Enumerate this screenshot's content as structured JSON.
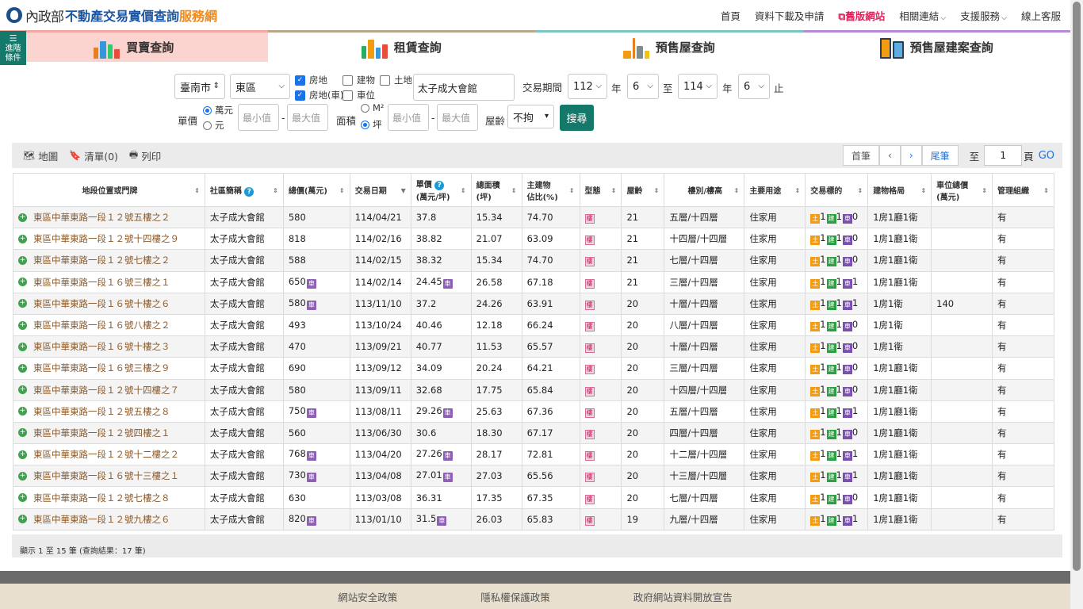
{
  "header": {
    "ministry": "內政部",
    "site_main": "不動產交易實價查詢",
    "site_sub": "服務網",
    "nav": [
      "首頁",
      "資料下載及申請",
      "舊版網站",
      "相關連結",
      "支援服務",
      "線上客服"
    ]
  },
  "advanced": {
    "line1": "進階",
    "line2": "條件"
  },
  "tabs": [
    "買賣查詢",
    "租賃查詢",
    "預售屋查詢",
    "預售屋建案查詢"
  ],
  "filters": {
    "city": "臺南市",
    "district": "東區",
    "types": [
      {
        "label": "房地",
        "checked": true
      },
      {
        "label": "建物",
        "checked": false
      },
      {
        "label": "土地",
        "checked": false
      },
      {
        "label": "房地(車)",
        "checked": true
      },
      {
        "label": "車位",
        "checked": false
      }
    ],
    "keyword": "太子成大會館",
    "period_label": "交易期間",
    "from_year": "112",
    "from_month": "6",
    "to_label": "至",
    "to_year": "114",
    "to_month": "6",
    "year_unit": "年",
    "end_label": "止",
    "unit_price_label": "單價",
    "price_unit_wan": "萬元",
    "price_unit_yuan": "元",
    "min_placeholder": "最小值",
    "max_placeholder": "最大值",
    "area_label": "面積",
    "area_unit_m2": "M²",
    "area_unit_ping": "坪",
    "age_label": "屋齡",
    "age_value": "不拘",
    "search_button": "搜尋"
  },
  "toolbar": {
    "map": "地圖",
    "list": "清單(0)",
    "print": "列印",
    "first": "首筆",
    "last": "尾筆",
    "to_label": "至",
    "page": "1",
    "page_unit": "頁",
    "go": "GO"
  },
  "table": {
    "headers": [
      "地段位置或門牌",
      "社區簡稱",
      "總價(萬元)",
      "交易日期",
      "單價",
      "(萬元/坪)",
      "總面積",
      "(坪)",
      "主建物",
      "佔比(%)",
      "型態",
      "屋齡",
      "樓別/樓高",
      "主要用途",
      "交易標的",
      "建物格局",
      "車位總價",
      "(萬元)",
      "管理組織"
    ],
    "rows": [
      {
        "addr": "東區中華東路一段１２號五樓之２",
        "comm": "太子成大會館",
        "total": "580",
        "tp": false,
        "date": "114/04/21",
        "unit": "37.8",
        "up": false,
        "area": "15.34",
        "ratio": "74.70",
        "age": "21",
        "floor": "五層/十四層",
        "use": "住家用",
        "l": "1",
        "h": "1",
        "c": "0",
        "layout": "1房1廳1衛",
        "park": "",
        "mgmt": "有"
      },
      {
        "addr": "東區中華東路一段１２號十四樓之９",
        "comm": "太子成大會館",
        "total": "818",
        "tp": false,
        "date": "114/02/16",
        "unit": "38.82",
        "up": false,
        "area": "21.07",
        "ratio": "63.09",
        "age": "21",
        "floor": "十四層/十四層",
        "use": "住家用",
        "l": "1",
        "h": "1",
        "c": "0",
        "layout": "1房1廳1衛",
        "park": "",
        "mgmt": "有"
      },
      {
        "addr": "東區中華東路一段１２號七樓之２",
        "comm": "太子成大會館",
        "total": "588",
        "tp": false,
        "date": "114/02/15",
        "unit": "38.32",
        "up": false,
        "area": "15.34",
        "ratio": "74.70",
        "age": "21",
        "floor": "七層/十四層",
        "use": "住家用",
        "l": "1",
        "h": "1",
        "c": "0",
        "layout": "1房1廳1衛",
        "park": "",
        "mgmt": "有"
      },
      {
        "addr": "東區中華東路一段１６號三樓之１",
        "comm": "太子成大會館",
        "total": "650",
        "tp": true,
        "date": "114/02/14",
        "unit": "24.45",
        "up": true,
        "area": "26.58",
        "ratio": "67.18",
        "age": "21",
        "floor": "三層/十四層",
        "use": "住家用",
        "l": "1",
        "h": "1",
        "c": "1",
        "layout": "1房1廳1衛",
        "park": "",
        "mgmt": "有"
      },
      {
        "addr": "東區中華東路一段１６號十樓之６",
        "comm": "太子成大會館",
        "total": "580",
        "tp": true,
        "date": "113/11/10",
        "unit": "37.2",
        "up": false,
        "area": "24.26",
        "ratio": "63.91",
        "age": "20",
        "floor": "十層/十四層",
        "use": "住家用",
        "l": "1",
        "h": "1",
        "c": "1",
        "layout": "1房1衛",
        "park": "140",
        "mgmt": "有"
      },
      {
        "addr": "東區中華東路一段１６號八樓之２",
        "comm": "太子成大會館",
        "total": "493",
        "tp": false,
        "date": "113/10/24",
        "unit": "40.46",
        "up": false,
        "area": "12.18",
        "ratio": "66.24",
        "age": "20",
        "floor": "八層/十四層",
        "use": "住家用",
        "l": "1",
        "h": "1",
        "c": "0",
        "layout": "1房1衛",
        "park": "",
        "mgmt": "有"
      },
      {
        "addr": "東區中華東路一段１６號十樓之３",
        "comm": "太子成大會館",
        "total": "470",
        "tp": false,
        "date": "113/09/21",
        "unit": "40.77",
        "up": false,
        "area": "11.53",
        "ratio": "65.57",
        "age": "20",
        "floor": "十層/十四層",
        "use": "住家用",
        "l": "1",
        "h": "1",
        "c": "0",
        "layout": "1房1衛",
        "park": "",
        "mgmt": "有"
      },
      {
        "addr": "東區中華東路一段１６號三樓之９",
        "comm": "太子成大會館",
        "total": "690",
        "tp": false,
        "date": "113/09/12",
        "unit": "34.09",
        "up": false,
        "area": "20.24",
        "ratio": "64.21",
        "age": "20",
        "floor": "三層/十四層",
        "use": "住家用",
        "l": "1",
        "h": "1",
        "c": "0",
        "layout": "1房1廳1衛",
        "park": "",
        "mgmt": "有"
      },
      {
        "addr": "東區中華東路一段１２號十四樓之７",
        "comm": "太子成大會館",
        "total": "580",
        "tp": false,
        "date": "113/09/11",
        "unit": "32.68",
        "up": false,
        "area": "17.75",
        "ratio": "65.84",
        "age": "20",
        "floor": "十四層/十四層",
        "use": "住家用",
        "l": "1",
        "h": "1",
        "c": "0",
        "layout": "1房1廳1衛",
        "park": "",
        "mgmt": "有"
      },
      {
        "addr": "東區中華東路一段１２號五樓之８",
        "comm": "太子成大會館",
        "total": "750",
        "tp": true,
        "date": "113/08/11",
        "unit": "29.26",
        "up": true,
        "area": "25.63",
        "ratio": "67.36",
        "age": "20",
        "floor": "五層/十四層",
        "use": "住家用",
        "l": "1",
        "h": "1",
        "c": "1",
        "layout": "1房1廳1衛",
        "park": "",
        "mgmt": "有"
      },
      {
        "addr": "東區中華東路一段１２號四樓之１",
        "comm": "太子成大會館",
        "total": "560",
        "tp": false,
        "date": "113/06/30",
        "unit": "30.6",
        "up": false,
        "area": "18.30",
        "ratio": "67.17",
        "age": "20",
        "floor": "四層/十四層",
        "use": "住家用",
        "l": "1",
        "h": "1",
        "c": "0",
        "layout": "1房1廳1衛",
        "park": "",
        "mgmt": "有"
      },
      {
        "addr": "東區中華東路一段１２號十二樓之２",
        "comm": "太子成大會館",
        "total": "768",
        "tp": true,
        "date": "113/04/20",
        "unit": "27.26",
        "up": true,
        "area": "28.17",
        "ratio": "72.81",
        "age": "20",
        "floor": "十二層/十四層",
        "use": "住家用",
        "l": "1",
        "h": "1",
        "c": "1",
        "layout": "1房1廳1衛",
        "park": "",
        "mgmt": "有"
      },
      {
        "addr": "東區中華東路一段１６號十三樓之１",
        "comm": "太子成大會館",
        "total": "730",
        "tp": true,
        "date": "113/04/08",
        "unit": "27.01",
        "up": true,
        "area": "27.03",
        "ratio": "65.56",
        "age": "20",
        "floor": "十三層/十四層",
        "use": "住家用",
        "l": "1",
        "h": "1",
        "c": "1",
        "layout": "1房1廳1衛",
        "park": "",
        "mgmt": "有"
      },
      {
        "addr": "東區中華東路一段１２號七樓之８",
        "comm": "太子成大會館",
        "total": "630",
        "tp": false,
        "date": "113/03/08",
        "unit": "36.31",
        "up": false,
        "area": "17.35",
        "ratio": "67.35",
        "age": "20",
        "floor": "七層/十四層",
        "use": "住家用",
        "l": "1",
        "h": "1",
        "c": "0",
        "layout": "1房1廳1衛",
        "park": "",
        "mgmt": "有"
      },
      {
        "addr": "東區中華東路一段１２號九樓之６",
        "comm": "太子成大會館",
        "total": "820",
        "tp": true,
        "date": "113/01/10",
        "unit": "31.5",
        "up": true,
        "area": "26.03",
        "ratio": "65.83",
        "age": "19",
        "floor": "九層/十四層",
        "use": "住家用",
        "l": "1",
        "h": "1",
        "c": "1",
        "layout": "1房1廳1衛",
        "park": "",
        "mgmt": "有"
      }
    ],
    "summary": "顯示 1 至 15 筆 (查詢結果：17 筆)"
  },
  "icons": {
    "land": "土",
    "house": "建",
    "car": "車",
    "bldg": "樓"
  },
  "footer": [
    "網站安全政策",
    "隱私權保護政策",
    "政府網站資料開放宣告"
  ]
}
